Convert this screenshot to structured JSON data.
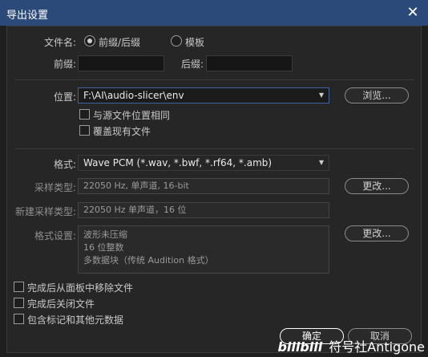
{
  "window": {
    "title": "导出设置",
    "close_glyph": "✕"
  },
  "filename": {
    "label": "文件名:",
    "option_prefix_suffix": "前缀/后缀",
    "option_template": "模板",
    "prefix_label": "前缀:",
    "suffix_label": "后缀:",
    "prefix_value": "",
    "suffix_value": ""
  },
  "location": {
    "label": "位置:",
    "value": "F:\\AI\\audio-slicer\\env",
    "browse_label": "浏览...",
    "same_as_source_label": "与源文件位置相同",
    "overwrite_label": "覆盖现有文件"
  },
  "format": {
    "label": "格式:",
    "value": "Wave PCM (*.wav, *.bwf, *.rf64, *.amb)",
    "sample_type_label": "采样类型:",
    "sample_type_value": "22050 Hz, 单声道, 16-bit",
    "change_label": "更改...",
    "new_sample_type_label": "新建采样类型:",
    "new_sample_type_value": "22050 Hz 单声道，16 位",
    "settings_label": "格式设置:",
    "settings_lines": [
      "波形未压缩",
      "16 位整数",
      "多数据块（传统 Audition 格式）"
    ],
    "settings_change_label": "更改..."
  },
  "options": {
    "remove_from_panel": "完成后从面板中移除文件",
    "close_after": "完成后关闭文件",
    "include_markers": "包含标记和其他元数据"
  },
  "buttons": {
    "ok": "确定",
    "cancel": "取消"
  },
  "watermark": {
    "logo": "bilibili",
    "text": "符号社Antigone"
  },
  "icons": {
    "dropdown": "▾"
  }
}
